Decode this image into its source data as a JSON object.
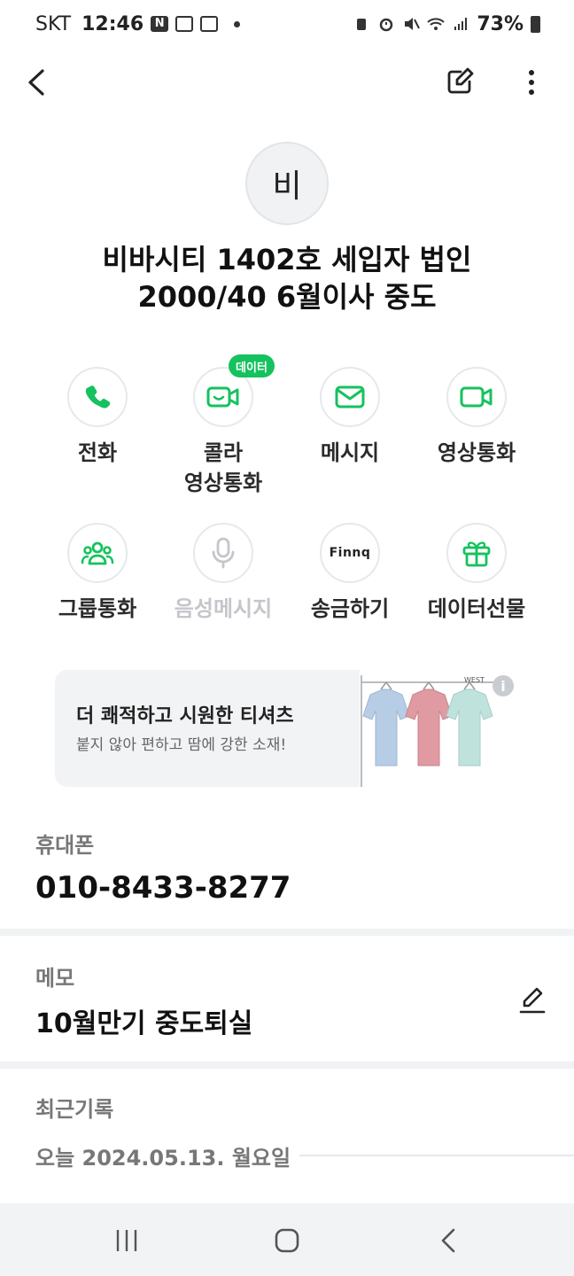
{
  "status_bar": {
    "carrier": "SKT",
    "time": "12:46",
    "battery": "73%"
  },
  "contact": {
    "avatar_initial": "비",
    "name_line1": "비바시티 1402호 세입자 법인",
    "name_line2": "2000/40 6월이사 중도"
  },
  "actions": {
    "call": "전화",
    "colla_video_line1": "콜라",
    "colla_video_line2": "영상통화",
    "message": "메시지",
    "video_call": "영상통화",
    "group_call": "그룹통화",
    "voice_message": "음성메시지",
    "send_money": "송금하기",
    "send_money_logo": "Finnq",
    "gift_data": "데이터선물",
    "data_badge": "데이터"
  },
  "ad": {
    "title": "더 쾌적하고 시원한 티셔츠",
    "subtitle": "붙지 않아 편하고 땀에 강한 소재!",
    "info": "i",
    "brand": "WEST"
  },
  "phone": {
    "label": "휴대폰",
    "number": "010-8433-8277"
  },
  "memo": {
    "label": "메모",
    "text": "10월만기 중도퇴실"
  },
  "recent": {
    "label": "최근기록",
    "date": "오늘 2024.05.13. 월요일"
  },
  "colors": {
    "accent": "#16c25e",
    "disabled": "#c4c6ca",
    "label": "#777777"
  }
}
